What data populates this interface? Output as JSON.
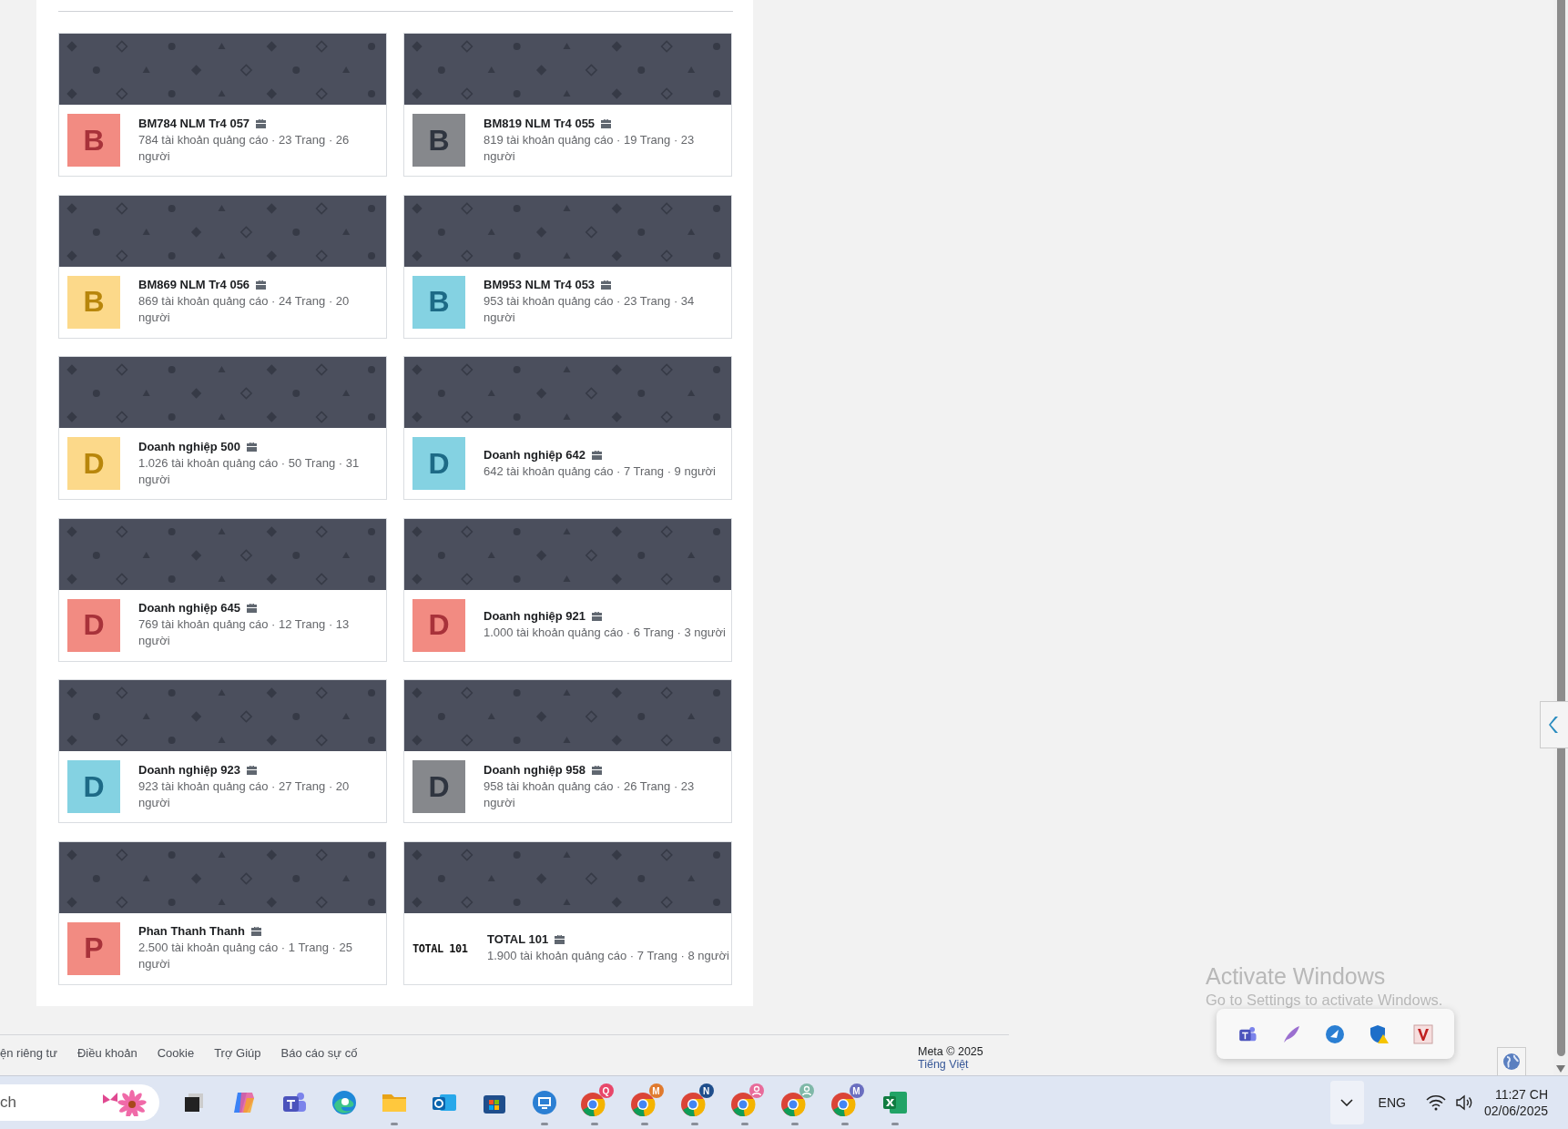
{
  "cards": [
    {
      "title": "BM784 NLM Tr4 057",
      "stats": "784 tài khoản quảng cáo · 23 Trang · 26 người",
      "avatar": {
        "kind": "letter",
        "text": "B",
        "color": "#f28b82"
      }
    },
    {
      "title": "BM819 NLM Tr4 055",
      "stats": "819 tài khoản quảng cáo · 19 Trang · 23 người",
      "avatar": {
        "kind": "letter",
        "text": "B",
        "color": "#86888c"
      }
    },
    {
      "title": "BM869 NLM Tr4 056",
      "stats": "869 tài khoản quảng cáo · 24 Trang · 20 người",
      "avatar": {
        "kind": "letter",
        "text": "B",
        "color": "#fcd98a"
      }
    },
    {
      "title": "BM953 NLM Tr4 053",
      "stats": "953 tài khoản quảng cáo · 23 Trang · 34 người",
      "avatar": {
        "kind": "letter",
        "text": "B",
        "color": "#84d2e2"
      }
    },
    {
      "title": "Doanh nghiệp 500",
      "stats": "1.026 tài khoản quảng cáo · 50 Trang · 31 người",
      "avatar": {
        "kind": "letter",
        "text": "D",
        "color": "#fcd98a"
      }
    },
    {
      "title": "Doanh nghiệp 642",
      "stats": "642 tài khoản quảng cáo · 7 Trang · 9 người",
      "avatar": {
        "kind": "letter",
        "text": "D",
        "color": "#84d2e2"
      }
    },
    {
      "title": "Doanh nghiệp 645",
      "stats": "769 tài khoản quảng cáo · 12 Trang · 13 người",
      "avatar": {
        "kind": "letter",
        "text": "D",
        "color": "#f28b82"
      }
    },
    {
      "title": "Doanh nghiệp 921",
      "stats": "1.000 tài khoản quảng cáo · 6 Trang · 3 người",
      "avatar": {
        "kind": "letter",
        "text": "D",
        "color": "#f28b82"
      }
    },
    {
      "title": "Doanh nghiệp 923",
      "stats": "923 tài khoản quảng cáo · 27 Trang · 20 người",
      "avatar": {
        "kind": "letter",
        "text": "D",
        "color": "#84d2e2"
      }
    },
    {
      "title": "Doanh nghiệp 958",
      "stats": "958 tài khoản quảng cáo · 26 Trang · 23 người",
      "avatar": {
        "kind": "letter",
        "text": "D",
        "color": "#86888c"
      }
    },
    {
      "title": "Phan Thanh Thanh",
      "stats": "2.500 tài khoản quảng cáo · 1 Trang · 25 người",
      "avatar": {
        "kind": "letter",
        "text": "P",
        "color": "#f28b82"
      }
    },
    {
      "title": "TOTAL 101",
      "stats": "1.900 tài khoản quảng cáo · 7 Trang · 8 người",
      "avatar": {
        "kind": "logo",
        "text": "TOTAL 101"
      }
    }
  ],
  "footer": {
    "links": [
      "ện riêng tư",
      "Điều khoản",
      "Cookie",
      "Trợ Giúp",
      "Báo cáo sự cố"
    ],
    "copyright": "Meta © 2025",
    "language": "Tiếng Việt"
  },
  "activation": {
    "title": "Activate Windows",
    "subtitle": "Go to Settings to activate Windows."
  },
  "tray_popup": [
    {
      "kind": "teams"
    },
    {
      "kind": "feather"
    },
    {
      "kind": "remote"
    },
    {
      "kind": "shield"
    },
    {
      "kind": "v"
    }
  ],
  "taskbar": {
    "search": {
      "placeholder": "ch"
    },
    "apps": [
      {
        "kind": "taskview",
        "running": false
      },
      {
        "kind": "copilot",
        "running": false
      },
      {
        "kind": "teams",
        "running": false
      },
      {
        "kind": "edge",
        "running": false
      },
      {
        "kind": "folder",
        "running": true
      },
      {
        "kind": "outlook",
        "running": false
      },
      {
        "kind": "store",
        "running": false
      },
      {
        "kind": "remote",
        "running": true
      },
      {
        "kind": "chrome",
        "badge": "Q",
        "color": "#e8476a",
        "running": true
      },
      {
        "kind": "chrome",
        "badge": "M",
        "color": "#e07a2e",
        "running": true
      },
      {
        "kind": "chrome",
        "badge": "N",
        "color": "#1f4e8c",
        "running": true
      },
      {
        "kind": "chrome",
        "color": "#e86b9a",
        "running": true
      },
      {
        "kind": "chrome",
        "color": "#7fb8a8",
        "running": true
      },
      {
        "kind": "chrome",
        "badge": "M",
        "color": "#6b6fc0",
        "running": true
      },
      {
        "kind": "excel",
        "running": true
      }
    ],
    "tray": {
      "language": "ENG",
      "time": "11:27 CH",
      "date": "02/06/2025"
    }
  }
}
